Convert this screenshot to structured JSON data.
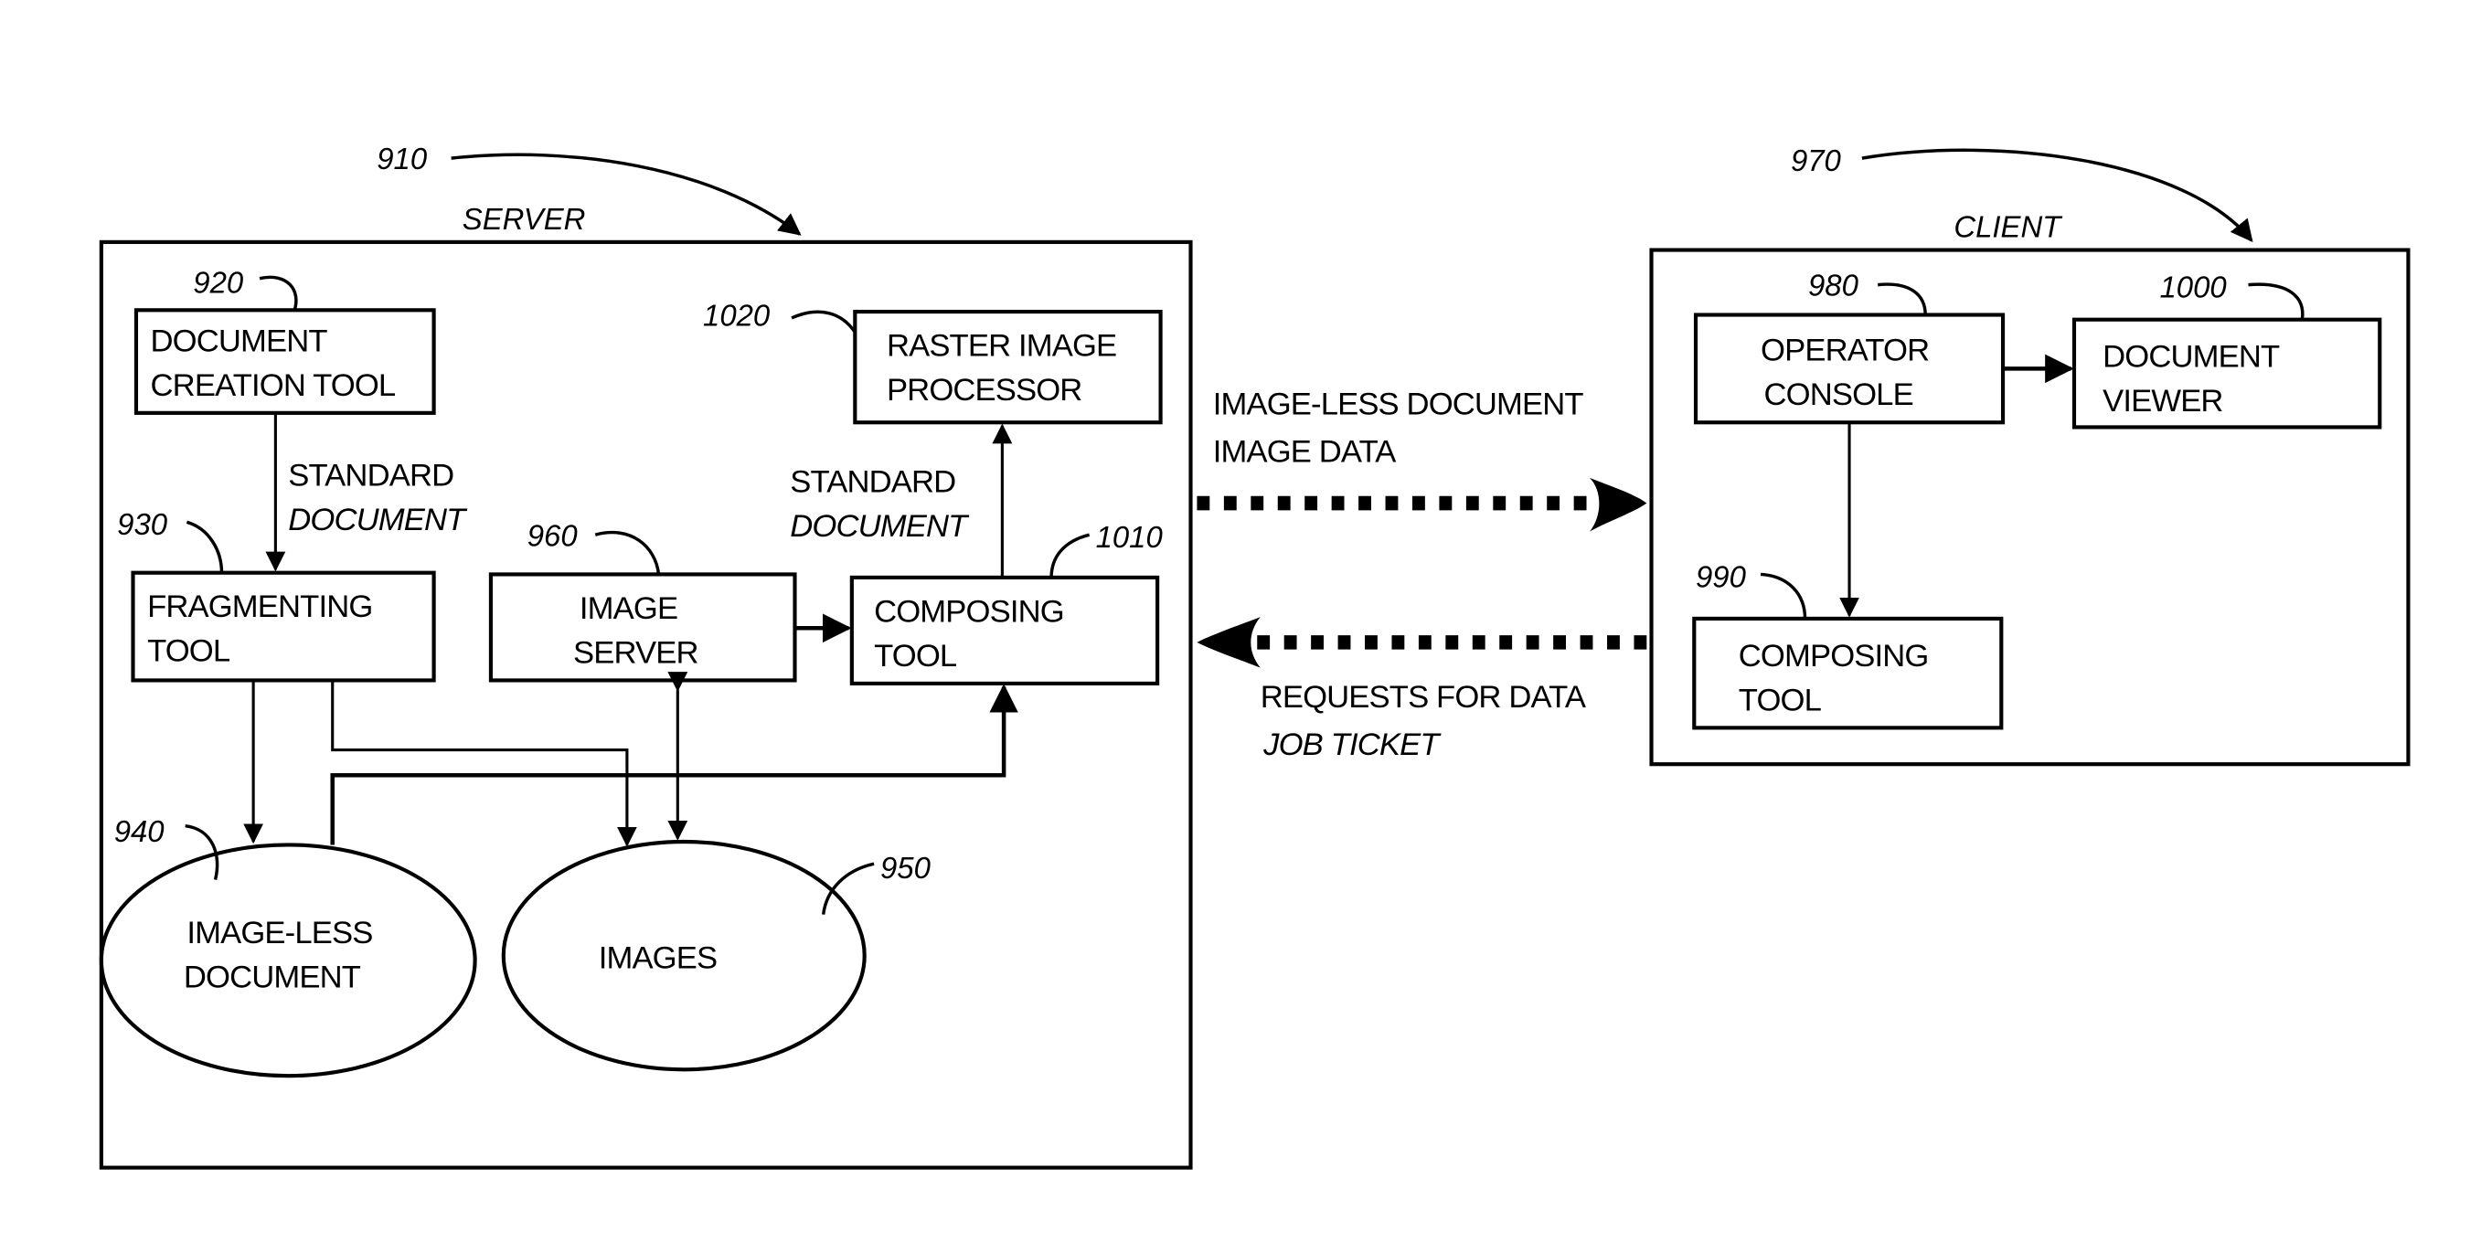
{
  "figure": {
    "server": {
      "title": "SERVER",
      "ref": "910"
    },
    "client": {
      "title": "CLIENT",
      "ref": "970"
    },
    "server_components": {
      "document_creation_tool": {
        "ref": "920",
        "lines": [
          "DOCUMENT",
          "CREATION TOOL"
        ]
      },
      "fragmenting_tool": {
        "ref": "930",
        "lines": [
          "FRAGMENTING",
          "TOOL"
        ]
      },
      "image_less_document": {
        "ref": "940",
        "lines": [
          "IMAGE-LESS",
          "DOCUMENT"
        ]
      },
      "images": {
        "ref": "950",
        "lines": [
          "IMAGES"
        ]
      },
      "image_server": {
        "ref": "960",
        "lines": [
          "IMAGE",
          "SERVER"
        ]
      },
      "composing_tool": {
        "ref": "1010",
        "lines": [
          "COMPOSING",
          "TOOL"
        ]
      },
      "raster_image_processor": {
        "ref": "1020",
        "lines": [
          "RASTER IMAGE",
          "PROCESSOR"
        ]
      }
    },
    "client_components": {
      "operator_console": {
        "ref": "980",
        "lines": [
          "OPERATOR",
          "CONSOLE"
        ]
      },
      "composing_tool": {
        "ref": "990",
        "lines": [
          "COMPOSING",
          "TOOL"
        ]
      },
      "document_viewer": {
        "ref": "1000",
        "lines": [
          "DOCUMENT",
          "VIEWER"
        ]
      }
    },
    "edge_labels": {
      "creation_to_fragmenting": [
        "STANDARD",
        "DOCUMENT"
      ],
      "composing_to_rip": [
        "STANDARD",
        "DOCUMENT"
      ],
      "server_to_client": [
        "IMAGE-LESS DOCUMENT",
        "IMAGE DATA"
      ],
      "client_to_server": [
        "REQUESTS FOR DATA",
        "JOB TICKET"
      ]
    }
  }
}
